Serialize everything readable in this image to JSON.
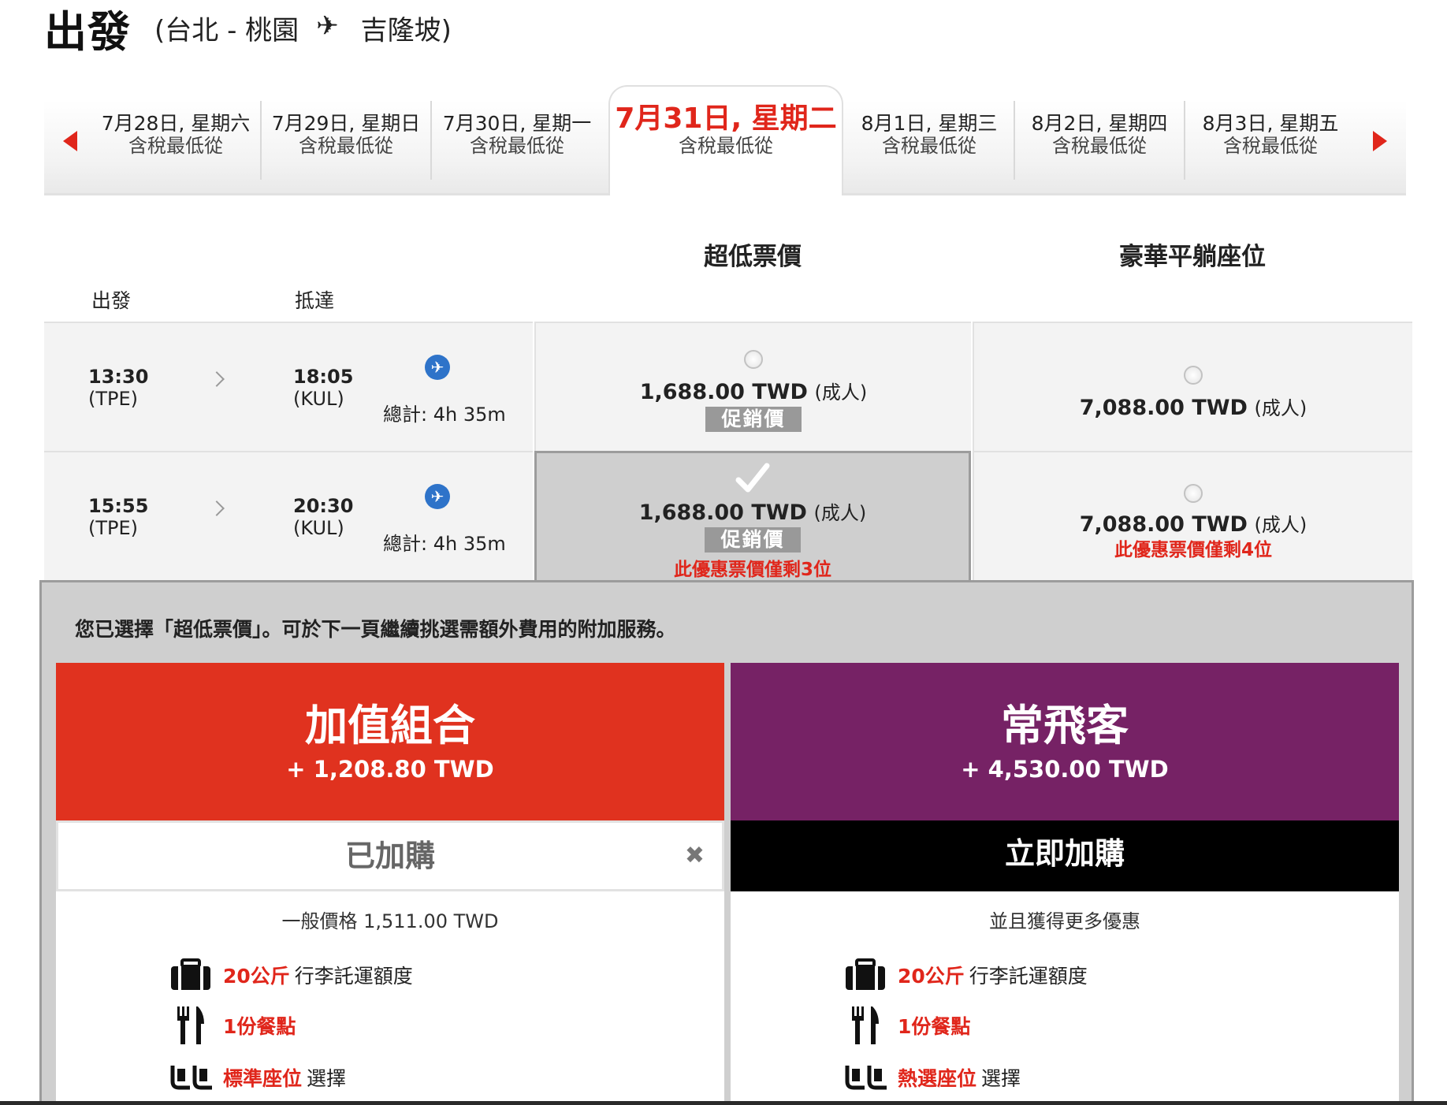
{
  "header": {
    "title": "出發",
    "route": "(台北 - 桃園",
    "destination": "吉隆坡)"
  },
  "dates": [
    {
      "date": "7月28日, 星期六",
      "sub": "含稅最低從"
    },
    {
      "date": "7月29日, 星期日",
      "sub": "含稅最低從"
    },
    {
      "date": "7月30日, 星期一",
      "sub": "含稅最低從"
    },
    {
      "date": "7月31日, 星期二",
      "sub": "含稅最低從"
    },
    {
      "date": "8月1日, 星期三",
      "sub": "含稅最低從"
    },
    {
      "date": "8月2日, 星期四",
      "sub": "含稅最低從"
    },
    {
      "date": "8月3日, 星期五",
      "sub": "含稅最低從"
    }
  ],
  "columns": {
    "low": "超低票價",
    "premium": "豪華平躺座位",
    "depart": "出發",
    "arrive": "抵達"
  },
  "flights": [
    {
      "dep_time": "13:30",
      "dep_code": "(TPE)",
      "arr_time": "18:05",
      "arr_code": "(KUL)",
      "total": "總計: 4h 35m",
      "low_price": "1,688.00 TWD",
      "low_unit": "(成人)",
      "promo": "促銷價",
      "premium_price": "7,088.00 TWD",
      "premium_unit": "(成人)"
    },
    {
      "dep_time": "15:55",
      "dep_code": "(TPE)",
      "arr_time": "20:30",
      "arr_code": "(KUL)",
      "total": "總計: 4h 35m",
      "low_price": "1,688.00 TWD",
      "low_unit": "(成人)",
      "promo": "促銷價",
      "low_seats": "此優惠票價僅剩3位",
      "premium_price": "7,088.00 TWD",
      "premium_unit": "(成人)",
      "premium_seats": "此優惠票價僅剩4位"
    }
  ],
  "panel": {
    "message": "您已選擇「超低票價」。可於下一頁繼續挑選需額外費用的附加服務。",
    "value_bundle": {
      "name": "加值組合",
      "price": "+ 1,208.80 TWD",
      "action": "已加購",
      "note": "一般價格 1,511.00 TWD",
      "features": [
        {
          "hl": "20公斤",
          "text": "行李託運額度"
        },
        {
          "hl": "1份餐點",
          "text": ""
        },
        {
          "hl": "標準座位",
          "text": "選擇"
        }
      ]
    },
    "frequent_bundle": {
      "name": "常飛客",
      "price": "+ 4,530.00 TWD",
      "action": "立即加購",
      "note": "並且獲得更多優惠",
      "features": [
        {
          "hl": "20公斤",
          "text": "行李託運額度"
        },
        {
          "hl": "1份餐點",
          "text": ""
        },
        {
          "hl": "熱選座位",
          "text": "選擇"
        }
      ]
    }
  },
  "colors": {
    "accent_red": "#e0261b",
    "value_red": "#e0321f",
    "frequent_purple": "#762265"
  }
}
